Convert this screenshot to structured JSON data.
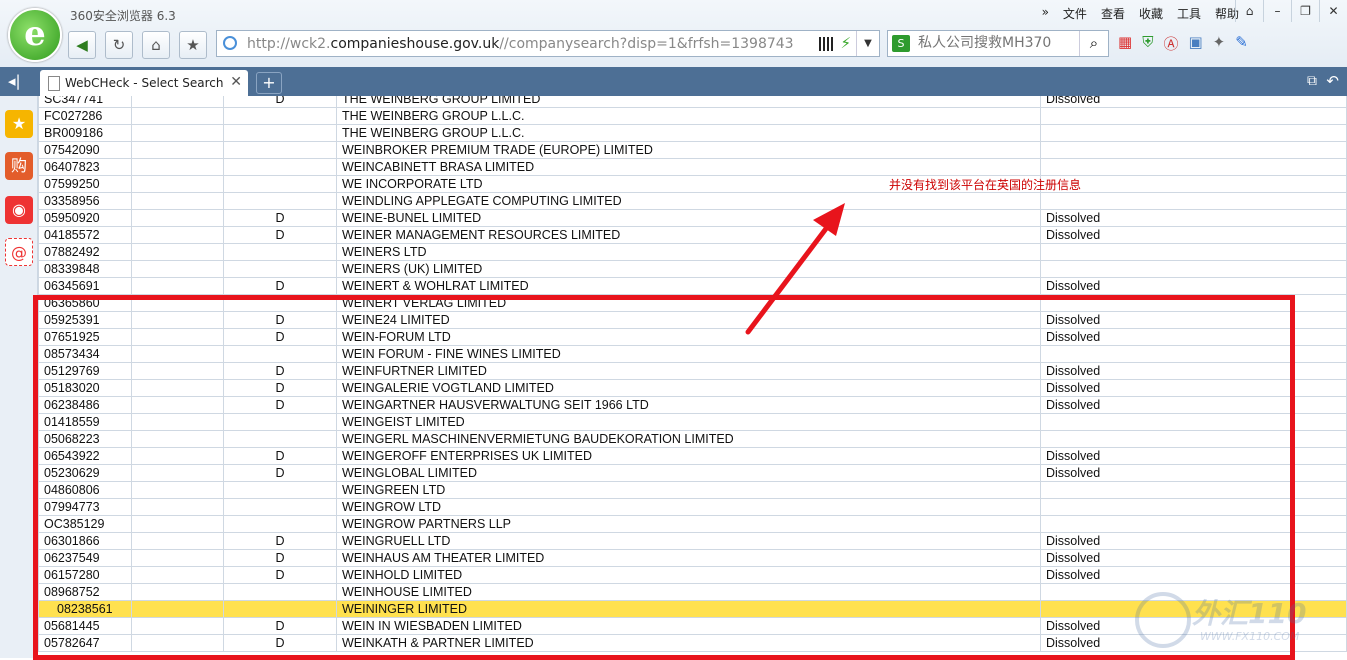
{
  "app": {
    "title": "360安全浏览器 6.3",
    "logo_letter": "e"
  },
  "menu": {
    "chevron": "»",
    "items": [
      "文件",
      "查看",
      "收藏",
      "工具",
      "帮助"
    ]
  },
  "address": {
    "prefix": "http://wck2.",
    "domain": "companieshouse.gov.uk",
    "path": "//companysearch?disp=1&frfsh=1398743"
  },
  "search": {
    "engine_label": "S",
    "placeholder": "私人公司搜救MH370"
  },
  "tab": {
    "label": "WebCHeck - Select Search Result"
  },
  "annotation": {
    "note": "并没有找到该平台在英国的注册信息"
  },
  "rows": [
    {
      "num": "SC347741",
      "flag": "D",
      "name": "THE WEINBERG GROUP LIMITED",
      "status": "Dissolved"
    },
    {
      "num": "FC027286",
      "flag": "",
      "name": "THE WEINBERG GROUP L.L.C.",
      "status": ""
    },
    {
      "num": "BR009186",
      "flag": "",
      "name": "THE WEINBERG GROUP L.L.C.",
      "status": ""
    },
    {
      "num": "07542090",
      "flag": "",
      "name": "WEINBROKER PREMIUM TRADE (EUROPE) LIMITED",
      "status": ""
    },
    {
      "num": "06407823",
      "flag": "",
      "name": "WEINCABINETT BRASA LIMITED",
      "status": ""
    },
    {
      "num": "07599250",
      "flag": "",
      "name": "WE INCORPORATE LTD",
      "status": ""
    },
    {
      "num": "03358956",
      "flag": "",
      "name": "WEINDLING APPLEGATE COMPUTING LIMITED",
      "status": ""
    },
    {
      "num": "05950920",
      "flag": "D",
      "name": "WEINE-BUNEL LIMITED",
      "status": "Dissolved"
    },
    {
      "num": "04185572",
      "flag": "D",
      "name": "WEINER MANAGEMENT RESOURCES LIMITED",
      "status": "Dissolved"
    },
    {
      "num": "07882492",
      "flag": "",
      "name": "WEINERS LTD",
      "status": ""
    },
    {
      "num": "08339848",
      "flag": "",
      "name": "WEINERS (UK) LIMITED",
      "status": ""
    },
    {
      "num": "06345691",
      "flag": "D",
      "name": "WEINERT & WOHLRAT LIMITED",
      "status": "Dissolved"
    },
    {
      "num": "06365860",
      "flag": "",
      "name": "WEINERT VERLAG LIMITED",
      "status": ""
    },
    {
      "num": "05925391",
      "flag": "D",
      "name": "WEINE24 LIMITED",
      "status": "Dissolved"
    },
    {
      "num": "07651925",
      "flag": "D",
      "name": "WEIN-FORUM LTD",
      "status": "Dissolved"
    },
    {
      "num": "08573434",
      "flag": "",
      "name": "WEIN FORUM - FINE WINES LIMITED",
      "status": ""
    },
    {
      "num": "05129769",
      "flag": "D",
      "name": "WEINFURTNER LIMITED",
      "status": "Dissolved"
    },
    {
      "num": "05183020",
      "flag": "D",
      "name": "WEINGALERIE VOGTLAND LIMITED",
      "status": "Dissolved"
    },
    {
      "num": "06238486",
      "flag": "D",
      "name": "WEINGARTNER HAUSVERWALTUNG SEIT 1966 LTD",
      "status": "Dissolved"
    },
    {
      "num": "01418559",
      "flag": "",
      "name": "WEINGEIST LIMITED",
      "status": ""
    },
    {
      "num": "05068223",
      "flag": "",
      "name": "WEINGERL MASCHINENVERMIETUNG BAUDEKORATION LIMITED",
      "status": ""
    },
    {
      "num": "06543922",
      "flag": "D",
      "name": "WEINGEROFF ENTERPRISES UK LIMITED",
      "status": "Dissolved"
    },
    {
      "num": "05230629",
      "flag": "D",
      "name": "WEINGLOBAL LIMITED",
      "status": "Dissolved"
    },
    {
      "num": "04860806",
      "flag": "",
      "name": "WEINGREEN LTD",
      "status": ""
    },
    {
      "num": "07994773",
      "flag": "",
      "name": "WEINGROW LTD",
      "status": ""
    },
    {
      "num": "OC385129",
      "flag": "",
      "name": "WEINGROW PARTNERS LLP",
      "status": ""
    },
    {
      "num": "06301866",
      "flag": "D",
      "name": "WEINGRUELL LTD",
      "status": "Dissolved"
    },
    {
      "num": "06237549",
      "flag": "D",
      "name": "WEINHAUS AM THEATER LIMITED",
      "status": "Dissolved"
    },
    {
      "num": "06157280",
      "flag": "D",
      "name": "WEINHOLD LIMITED",
      "status": "Dissolved"
    },
    {
      "num": "08968752",
      "flag": "",
      "name": "WEINHOUSE LIMITED",
      "status": ""
    },
    {
      "num": "08238561",
      "flag": "",
      "name": "WEININGER LIMITED",
      "status": "",
      "highlight": true
    },
    {
      "num": "05681445",
      "flag": "D",
      "name": "WEIN IN WIESBADEN LIMITED",
      "status": "Dissolved"
    },
    {
      "num": "05782647",
      "flag": "D",
      "name": "WEINKATH & PARTNER LIMITED",
      "status": "Dissolved"
    }
  ],
  "watermark": {
    "text": "外汇110",
    "url": "WWW.FX110.COM"
  },
  "colors": {
    "annotation_red": "#e8141c",
    "highlight": "#ffe14f",
    "tabbar": "#4d6f95"
  }
}
